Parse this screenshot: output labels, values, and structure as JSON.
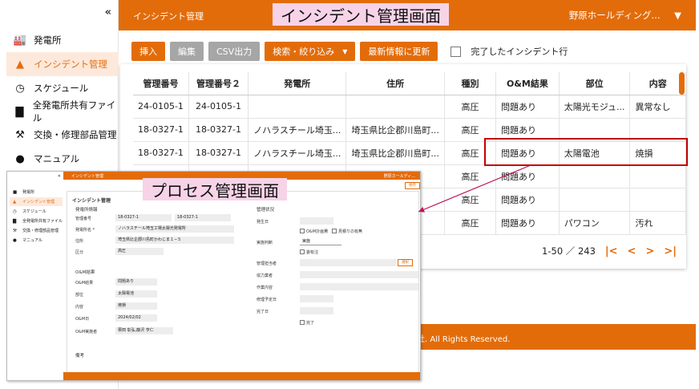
{
  "sidebar": {
    "collapse_glyph": "«",
    "items": [
      {
        "label": "発電所",
        "icon": "factory-icon"
      },
      {
        "label": "インシデント管理",
        "icon": "warning-icon",
        "active": true
      },
      {
        "label": "スケジュール",
        "icon": "clock-icon"
      },
      {
        "label": "全発電所共有ファイル",
        "icon": "file-icon"
      },
      {
        "label": "交換・修理部品管理",
        "icon": "tools-icon"
      },
      {
        "label": "マニュアル",
        "icon": "info-icon"
      }
    ]
  },
  "header": {
    "title": "インシデント管理",
    "org": "野原ホールディング..."
  },
  "toolbar": {
    "insert": "挿入",
    "edit": "編集",
    "csv": "CSV出力",
    "search": "検索・絞り込み",
    "refresh": "最新情報に更新",
    "completed_label": "完了したインシデント行"
  },
  "table": {
    "headers": [
      "管理番号",
      "管理番号２",
      "発電所",
      "住所",
      "種別",
      "O&M結果",
      "部位",
      "内容"
    ],
    "rows": [
      [
        "24-0105-1",
        "24-0105-1",
        "",
        "",
        "高圧",
        "問題あり",
        "太陽光モジュ...",
        "異常なし"
      ],
      [
        "18-0327-1",
        "18-0327-1",
        "ノハラスチール埼玉...",
        "埼玉県比企郡川島町...",
        "高圧",
        "問題あり",
        "",
        ""
      ],
      [
        "18-0327-1",
        "18-0327-1",
        "ノハラスチール埼玉...",
        "埼玉県比企郡川島町...",
        "高圧",
        "問題あり",
        "太陽電池",
        "焼損"
      ],
      [
        "",
        "",
        "",
        "",
        "高圧",
        "問題あり",
        "",
        ""
      ],
      [
        "",
        "",
        "",
        "",
        "高圧",
        "問題あり",
        "",
        ""
      ],
      [
        "",
        "",
        "",
        "",
        "高圧",
        "問題あり",
        "パワコン",
        "汚れ"
      ]
    ]
  },
  "pager": {
    "range": "1-50 ／ 243"
  },
  "footer": {
    "text": "社. All Rights Reserved."
  },
  "annotations": {
    "main_title": "インシデント管理画面",
    "process_title": "プロセス管理画面"
  },
  "inset": {
    "header_title": "インシデント管理",
    "header_org": "野原ホールディ...",
    "save": "保存",
    "page_title": "インシデント管理",
    "sec_incident": "発電所情報",
    "sec_om": "O&M結果",
    "sec_status": "管理状況",
    "sec_remarks": "備考",
    "left_fields": [
      {
        "label": "管理番号",
        "value": "18-0327-1",
        "value2": "18-0327-1"
      },
      {
        "label": "発電所名 *",
        "value": "ノハラスチール埼玉工場太陽光発電所"
      },
      {
        "label": "住所",
        "value": "埼玉県比企郡川島町かわじま１−５"
      },
      {
        "label": "区分",
        "value": "高圧"
      }
    ],
    "om_fields": [
      {
        "label": "O&M結果",
        "value": "問題あり"
      },
      {
        "label": "部位",
        "value": "太陽電池"
      },
      {
        "label": "内容",
        "value": "焼損"
      },
      {
        "label": "O&M日",
        "value": "2024/02/02"
      },
      {
        "label": "O&M実施者",
        "value": "栗田 彰弘,藤沢 亨仁"
      }
    ],
    "right_fields": [
      {
        "label": "発生日"
      },
      {
        "label": "実施判断",
        "value": "実施"
      },
      {
        "label": "管理担当者"
      },
      {
        "label": "協力業者"
      },
      {
        "label": "作業内容"
      },
      {
        "label": "修理予定日"
      },
      {
        "label": "完了日"
      }
    ],
    "chk_om": "O&M計画費",
    "chk_quote": "見積りの有無",
    "chk_paid": "委有注",
    "chk_done": "完了",
    "select_btn": "選択"
  }
}
